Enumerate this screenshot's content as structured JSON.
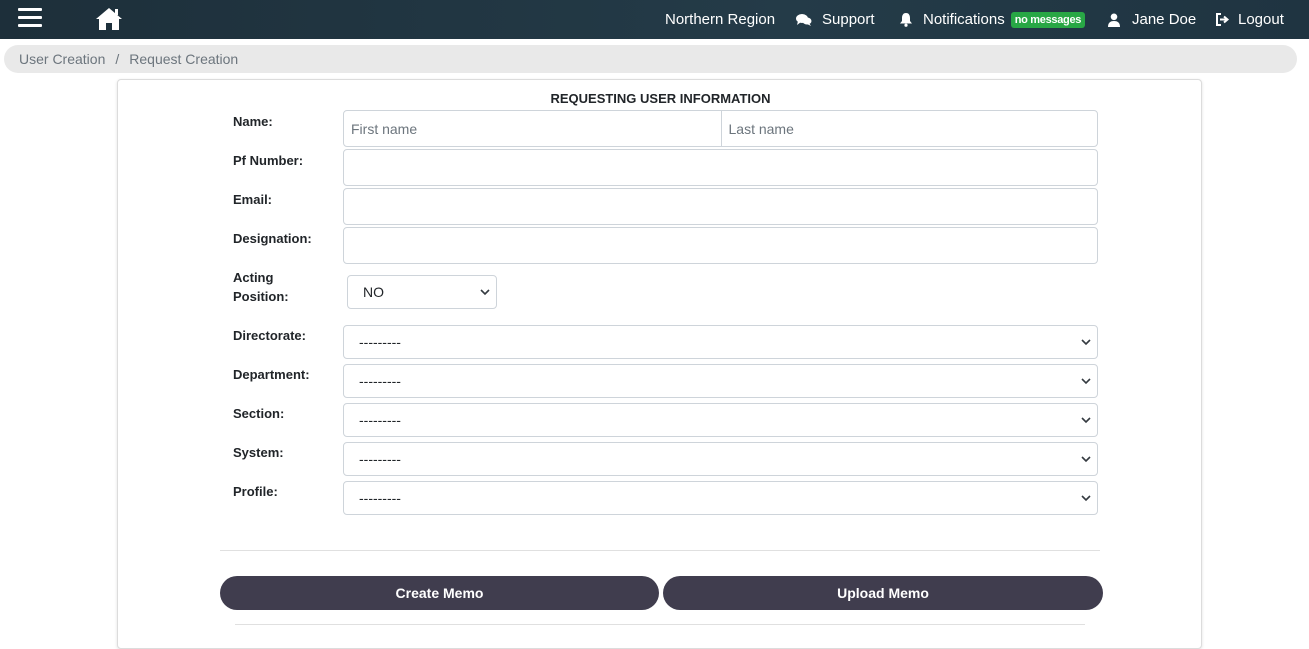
{
  "navbar": {
    "menu_icon": "hamburger-icon",
    "home_icon": "home-icon",
    "region": "Northern Region",
    "support": "Support",
    "notifications": "Notifications",
    "notifications_badge": "no messages",
    "user": "Jane Doe",
    "logout": "Logout",
    "badge_color": "#28a745",
    "bar_color": "#1f3441"
  },
  "breadcrumb": {
    "items": [
      "User Creation",
      "Request Creation"
    ],
    "separator": "/"
  },
  "form": {
    "title": "REQUESTING USER INFORMATION",
    "name_label": "Name:",
    "first_name_placeholder": "First name",
    "last_name_placeholder": "Last name",
    "pf_number_label": "Pf Number:",
    "email_label": "Email:",
    "designation_label": "Designation:",
    "acting_label_line1": "Acting",
    "acting_label_line2": "Position:",
    "acting_value": "NO",
    "directorate_label": "Directorate:",
    "directorate_value": "---------",
    "department_label": "Department:",
    "department_value": "---------",
    "section_label": "Section:",
    "section_value": "---------",
    "system_label": "System:",
    "system_value": "---------",
    "profile_label": "Profile:",
    "profile_value": "---------"
  },
  "actions": {
    "create_memo": "Create Memo",
    "upload_memo": "Upload Memo",
    "button_color": "#403d4e"
  }
}
